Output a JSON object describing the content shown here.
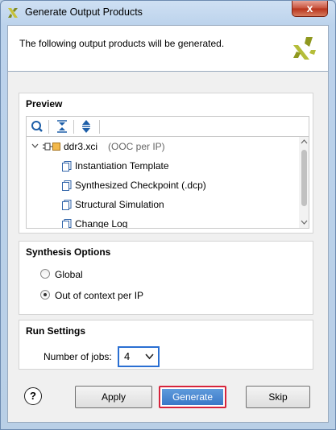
{
  "window": {
    "title": "Generate Output Products",
    "close_label": "x"
  },
  "header": {
    "message": "The following output products will be generated."
  },
  "preview": {
    "title": "Preview",
    "toolbar_icons": [
      "search-icon",
      "collapse-all-icon",
      "expand-all-icon"
    ],
    "root": {
      "name": "ddr3.xci",
      "note": "(OOC per IP)",
      "expanded": true
    },
    "items": [
      "Instantiation Template",
      "Synthesized Checkpoint (.dcp)",
      "Structural Simulation",
      "Change Log"
    ]
  },
  "synthesis": {
    "title": "Synthesis Options",
    "options": [
      {
        "label": "Global",
        "checked": false
      },
      {
        "label": "Out of context per IP",
        "checked": true
      }
    ]
  },
  "run_settings": {
    "title": "Run Settings",
    "jobs_label": "Number of jobs:",
    "jobs_value": "4"
  },
  "buttons": {
    "help": "?",
    "apply": "Apply",
    "generate": "Generate",
    "skip": "Skip"
  },
  "colors": {
    "accent": "#3a78c8",
    "highlight_border": "#d6243c",
    "xilinx_logo": "#b5bd3a"
  }
}
